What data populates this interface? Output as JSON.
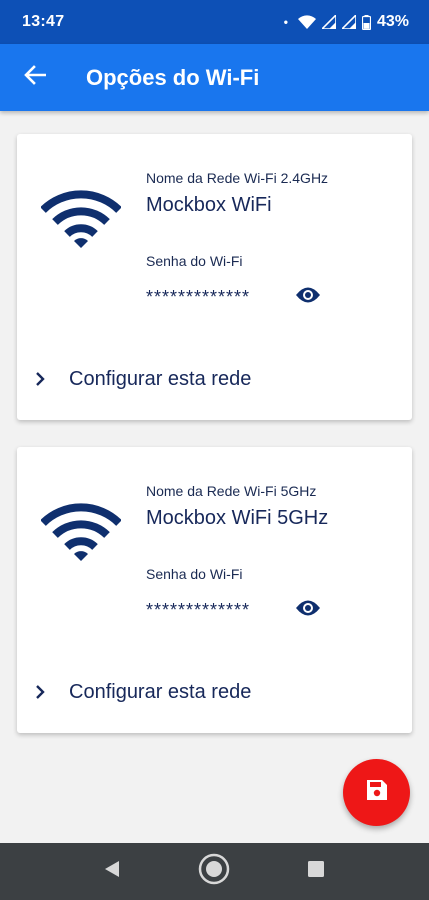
{
  "status_bar": {
    "time": "13:47",
    "dot": "•",
    "battery": "43%"
  },
  "app_bar": {
    "title": "Opções do Wi-Fi",
    "back_icon": "arrow-back-icon"
  },
  "networks": [
    {
      "name_label": "Nome da Rede Wi-Fi 2.4GHz",
      "name": "Mockbox WiFi",
      "password_label": "Senha do Wi-Fi",
      "password": "*************",
      "configure_label": "Configurar esta rede"
    },
    {
      "name_label": "Nome da Rede Wi-Fi 5GHz",
      "name": "Mockbox WiFi 5GHz",
      "password_label": "Senha do Wi-Fi",
      "password": "*************",
      "configure_label": "Configurar esta rede"
    }
  ],
  "fab": {
    "icon": "save-icon"
  },
  "colors": {
    "status_bar": "#0d50b6",
    "app_bar": "#1976ee",
    "text_dark": "#17285a",
    "fab": "#ee1717",
    "nav_bar": "#3c4043"
  }
}
